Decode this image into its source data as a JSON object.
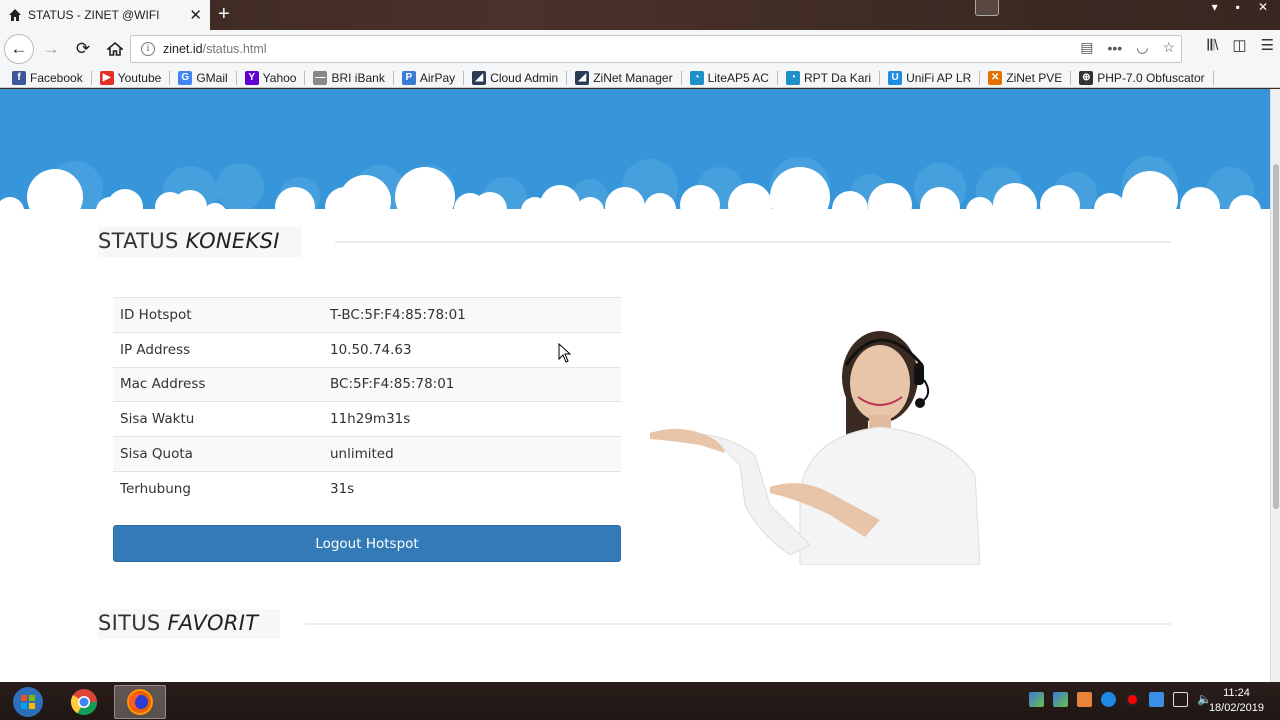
{
  "browser": {
    "tab_title": "STATUS - ZINET @WIFI",
    "new_tab_symbol": "+",
    "close_symbol": "✕",
    "url_host": "zinet.id",
    "url_path": "/status.html",
    "window_controls": [
      "▾",
      "▪",
      "✕"
    ]
  },
  "bookmarks": [
    {
      "label": "Facebook",
      "icon": "facebook-icon",
      "color": "#3b5998",
      "glyph": "f"
    },
    {
      "label": "Youtube",
      "icon": "youtube-icon",
      "color": "#e52d27",
      "glyph": "▶"
    },
    {
      "label": "GMail",
      "icon": "google-icon",
      "color": "#4285f4",
      "glyph": "G"
    },
    {
      "label": "Yahoo",
      "icon": "yahoo-icon",
      "color": "#5f01d1",
      "glyph": "Y"
    },
    {
      "label": "BRI iBank",
      "icon": "bri-icon",
      "color": "#888888",
      "glyph": "—"
    },
    {
      "label": "AirPay",
      "icon": "airpay-icon",
      "color": "#3a7bd5",
      "glyph": "P"
    },
    {
      "label": "Cloud Admin",
      "icon": "mikrotik-icon",
      "color": "#2b3a55",
      "glyph": "◢"
    },
    {
      "label": "ZiNet Manager",
      "icon": "mikrotik-icon",
      "color": "#2b3a55",
      "glyph": "◢"
    },
    {
      "label": "LiteAP5 AC",
      "icon": "rss-icon",
      "color": "#1e90c8",
      "glyph": "◔"
    },
    {
      "label": "RPT Da Kari",
      "icon": "rss-icon",
      "color": "#1e90c8",
      "glyph": "◔"
    },
    {
      "label": "UniFi AP LR",
      "icon": "unifi-icon",
      "color": "#1f8ee0",
      "glyph": "U"
    },
    {
      "label": "ZiNet PVE",
      "icon": "proxmox-icon",
      "color": "#e57000",
      "glyph": "✕"
    },
    {
      "label": "PHP-7.0 Obfuscator",
      "icon": "globe-icon",
      "color": "#333333",
      "glyph": "⊕"
    }
  ],
  "page": {
    "status_title_a": "STATUS",
    "status_title_b": "KONEKSI",
    "favorit_title_a": "SITUS",
    "favorit_title_b": "FAVORIT",
    "status_rows": [
      {
        "label": "ID Hotspot",
        "value": "T-BC:5F:F4:85:78:01"
      },
      {
        "label": "IP Address",
        "value": "10.50.74.63"
      },
      {
        "label": "Mac Address",
        "value": "BC:5F:F4:85:78:01"
      },
      {
        "label": "Sisa Waktu",
        "value": "11h29m31s"
      },
      {
        "label": "Sisa Quota",
        "value": "unlimited"
      },
      {
        "label": "Terhubung",
        "value": "31s"
      }
    ],
    "logout_label": "Logout Hotspot",
    "accent": "#337ab7",
    "header_color": "#3696d9"
  },
  "taskbar": {
    "apps": [
      "windows-start",
      "chrome",
      "firefox"
    ],
    "time": "11:24",
    "date": "18/02/2019"
  }
}
